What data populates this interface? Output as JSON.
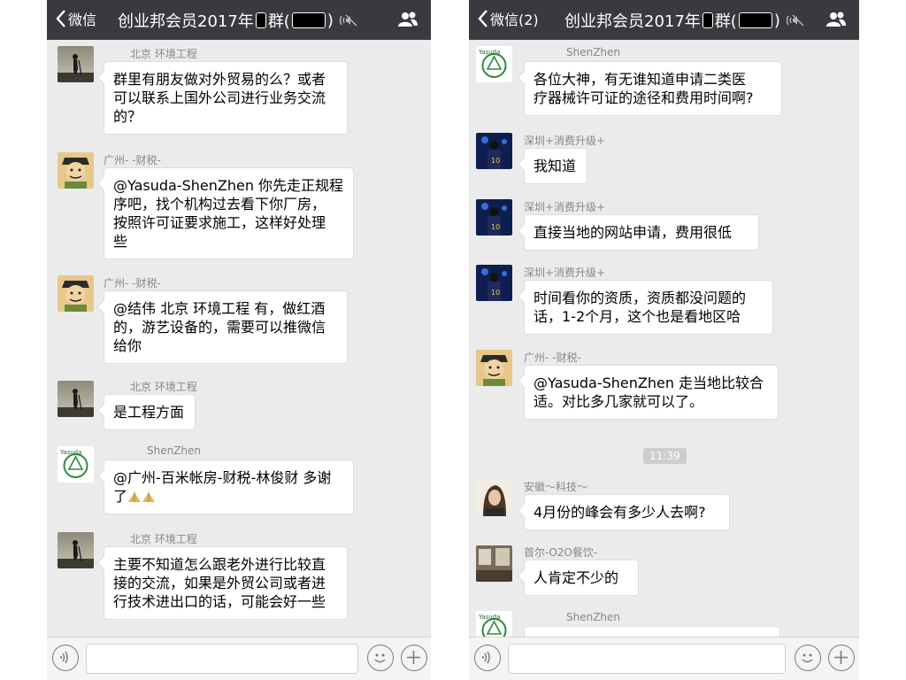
{
  "left": {
    "back_label": "微信",
    "title_prefix": "创业邦会员2017年",
    "title_suffix": "群(",
    "title_close": ")",
    "messages": [
      {
        "sender": "北京 环境工程",
        "text": "群里有朋友做对外贸易的么？或者\n可以联系上国外公司进行业务交流\n的？"
      },
      {
        "sender": "广州-            -财税-",
        "text": "@Yasuda-ShenZhen 你先走正规程\n序吧，找个机构过去看下你厂房，\n按照许可证要求施工，这样好处理\n些"
      },
      {
        "sender": "广州-            -财税-",
        "text": "@结伟 北京 环境工程 有，做红酒\n的，游艺设备的，需要可以推微信\n给你"
      },
      {
        "sender": "北京 环境工程",
        "text": "是工程方面"
      },
      {
        "sender": "ShenZhen",
        "text": "@广州-百米帐房-财税-林俊财 多谢\n了"
      },
      {
        "sender": "北京 环境工程",
        "text": "主要不知道怎么跟老外进行比较直\n接的交流，如果是外贸公司或者进\n行技术进出口的话，可能会好一些"
      }
    ]
  },
  "right": {
    "back_label": "微信(2)",
    "title_prefix": "创业邦会员2017年",
    "title_suffix": "群(",
    "title_close": ")",
    "timestamp": "11:39",
    "messages": [
      {
        "sender": "ShenZhen",
        "text": "各位大神，有无谁知道申请二类医\n疗器械许可证的途径和费用时间啊?"
      },
      {
        "sender": "深圳+消费升级+",
        "text": "我知道"
      },
      {
        "sender": "深圳+消费升级+",
        "text": "直接当地的网站申请，费用很低"
      },
      {
        "sender": "深圳+消费升级+",
        "text": "时间看你的资质，资质都没问题的\n话，1-2个月，这个也是看地区哈"
      },
      {
        "sender": "广州-            -财税-",
        "text": "@Yasuda-ShenZhen 走当地比较合\n适。对比多几家就可以了。"
      },
      {
        "sender": "安徽～科技～",
        "text": "4月份的峰会有多少人去啊?"
      },
      {
        "sender": "首尔-O2O餐饮-",
        "text": "人肯定不少的"
      },
      {
        "sender": "ShenZhen",
        "text": ""
      }
    ]
  }
}
